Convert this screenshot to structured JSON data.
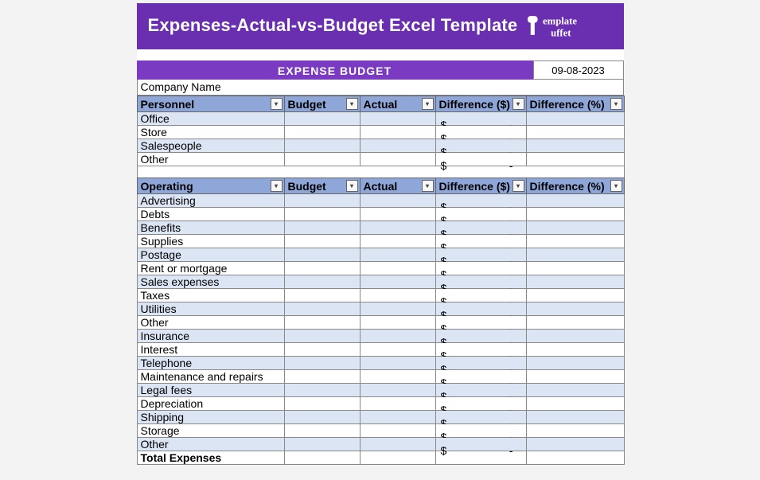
{
  "header": {
    "title": "Expenses-Actual-vs-Budget Excel Template",
    "logo_text": "emplate uffet"
  },
  "subhead": {
    "title": "EXPENSE BUDGET",
    "date": "09-08-2023"
  },
  "company_label": "Company Name",
  "sections": [
    {
      "headers": [
        "Personnel",
        "Budget",
        "Actual",
        "Difference ($)",
        "Difference (%)"
      ],
      "rows": [
        {
          "label": "Office",
          "diff_cur": "$",
          "diff_dash": "-"
        },
        {
          "label": "Store",
          "diff_cur": "$",
          "diff_dash": "-"
        },
        {
          "label": "Salespeople",
          "diff_cur": "$",
          "diff_dash": "-"
        },
        {
          "label": "Other",
          "diff_cur": "$",
          "diff_dash": "-"
        }
      ]
    },
    {
      "headers": [
        "Operating",
        "Budget",
        "Actual",
        "Difference ($)",
        "Difference (%)"
      ],
      "rows": [
        {
          "label": "Advertising",
          "diff_cur": "$",
          "diff_dash": "-"
        },
        {
          "label": "Debts",
          "diff_cur": "$",
          "diff_dash": "-"
        },
        {
          "label": "Benefits",
          "diff_cur": "$",
          "diff_dash": "-"
        },
        {
          "label": "Supplies",
          "diff_cur": "$",
          "diff_dash": "-"
        },
        {
          "label": "Postage",
          "diff_cur": "$",
          "diff_dash": "-"
        },
        {
          "label": "Rent or mortgage",
          "diff_cur": "$",
          "diff_dash": "-"
        },
        {
          "label": "Sales expenses",
          "diff_cur": "$",
          "diff_dash": "-"
        },
        {
          "label": "Taxes",
          "diff_cur": "$",
          "diff_dash": "-"
        },
        {
          "label": "Utilities",
          "diff_cur": "$",
          "diff_dash": "-"
        },
        {
          "label": "Other",
          "diff_cur": "$",
          "diff_dash": "-"
        },
        {
          "label": "Insurance",
          "diff_cur": "$",
          "diff_dash": "-"
        },
        {
          "label": "Interest",
          "diff_cur": "$",
          "diff_dash": "-"
        },
        {
          "label": "Telephone",
          "diff_cur": "$",
          "diff_dash": "-"
        },
        {
          "label": "Maintenance and repairs",
          "diff_cur": "$",
          "diff_dash": "-"
        },
        {
          "label": "Legal fees",
          "diff_cur": "$",
          "diff_dash": "-"
        },
        {
          "label": "Depreciation",
          "diff_cur": "$",
          "diff_dash": "-"
        },
        {
          "label": "Shipping",
          "diff_cur": "$",
          "diff_dash": "-"
        },
        {
          "label": "Storage",
          "diff_cur": "$",
          "diff_dash": "-"
        },
        {
          "label": "Other",
          "diff_cur": "$",
          "diff_dash": "-"
        }
      ]
    }
  ],
  "total_label": "Total Expenses"
}
